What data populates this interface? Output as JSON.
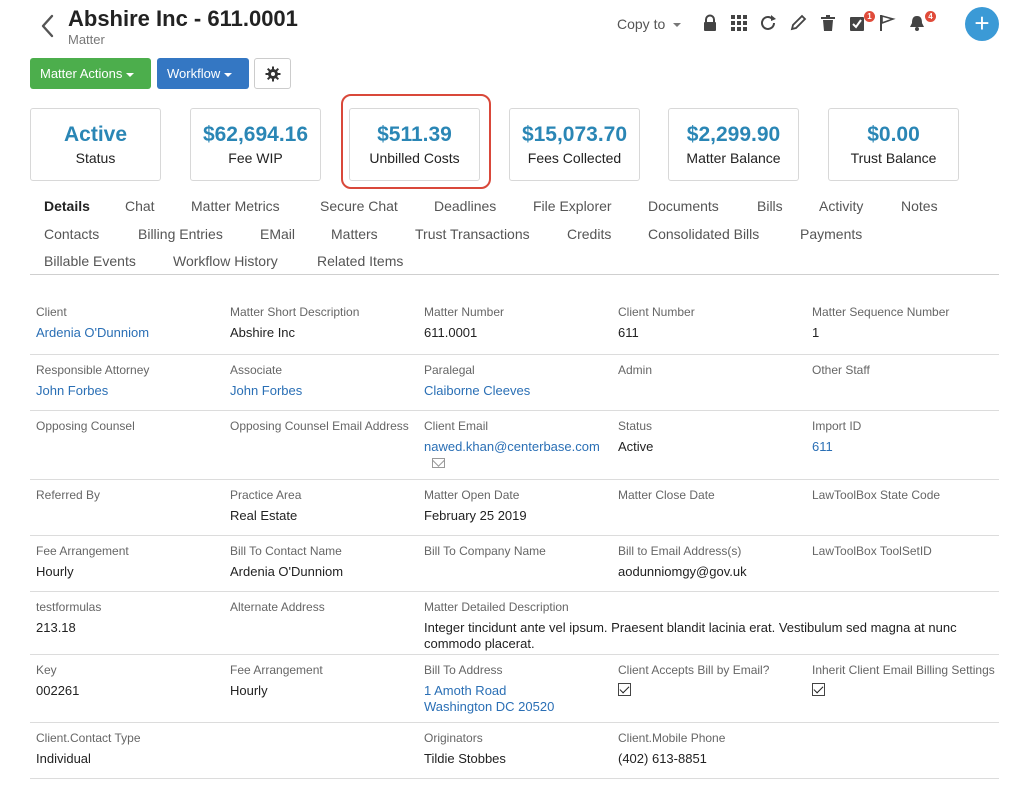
{
  "header": {
    "title": "Abshire Inc - 611.0001",
    "subtitle": "Matter",
    "copy_to": "Copy to",
    "task_badge": "1",
    "notification_badge": "4",
    "add_label": "+"
  },
  "actions": {
    "matter_actions": "Matter Actions",
    "workflow": "Workflow"
  },
  "stats": [
    {
      "value": "Active",
      "label": "Status"
    },
    {
      "value": "$62,694.16",
      "label": "Fee WIP"
    },
    {
      "value": "$511.39",
      "label": "Unbilled Costs"
    },
    {
      "value": "$15,073.70",
      "label": "Fees Collected"
    },
    {
      "value": "$2,299.90",
      "label": "Matter Balance"
    },
    {
      "value": "$0.00",
      "label": "Trust Balance"
    }
  ],
  "tabs": [
    "Details",
    "Chat",
    "Matter Metrics",
    "Secure Chat",
    "Deadlines",
    "File Explorer",
    "Documents",
    "Bills",
    "Activity",
    "Notes",
    "Contacts",
    "Billing Entries",
    "EMail",
    "Matters",
    "Trust Transactions",
    "Credits",
    "Consolidated Bills",
    "Payments",
    "Billable Events",
    "Workflow History",
    "Related Items"
  ],
  "details": [
    [
      {
        "label": "Client",
        "value": "Ardenia O'Dunniom",
        "link": true
      },
      {
        "label": "Matter Short Description",
        "value": "Abshire Inc"
      },
      {
        "label": "Matter Number",
        "value": "611.0001"
      },
      {
        "label": "Client Number",
        "value": "611"
      },
      {
        "label": "Matter Sequence Number",
        "value": "1"
      }
    ],
    [
      {
        "label": "Responsible Attorney",
        "value": "John Forbes",
        "link": true
      },
      {
        "label": "Associate",
        "value": "John Forbes",
        "link": true
      },
      {
        "label": "Paralegal",
        "value": "Claiborne Cleeves",
        "link": true
      },
      {
        "label": "Admin",
        "value": ""
      },
      {
        "label": "Other Staff",
        "value": ""
      }
    ],
    [
      {
        "label": "Opposing Counsel",
        "value": ""
      },
      {
        "label": "Opposing Counsel Email Address",
        "value": ""
      },
      {
        "label": "Client Email",
        "value": "nawed.khan@centerbase.com",
        "link": true
      },
      {
        "label": "Status",
        "value": "Active"
      },
      {
        "label": "Import ID",
        "value": "611",
        "link": true
      }
    ],
    [
      {
        "label": "Referred By",
        "value": ""
      },
      {
        "label": "Practice Area",
        "value": "Real Estate"
      },
      {
        "label": "Matter Open Date",
        "value": "February 25 2019"
      },
      {
        "label": "Matter Close Date",
        "value": ""
      },
      {
        "label": "LawToolBox State Code",
        "value": ""
      }
    ],
    [
      {
        "label": "Fee Arrangement",
        "value": "Hourly"
      },
      {
        "label": "Bill To Contact Name",
        "value": "Ardenia O'Dunniom"
      },
      {
        "label": "Bill To Company Name",
        "value": ""
      },
      {
        "label": "Bill to Email Address(s)",
        "value": "aodunniomgy@gov.uk"
      },
      {
        "label": "LawToolBox ToolSetID",
        "value": ""
      }
    ],
    [
      {
        "label": "testformulas",
        "value": "213.18"
      },
      {
        "label": "Alternate Address",
        "value": ""
      },
      {
        "label": "Matter Detailed Description",
        "value": "Integer tincidunt ante vel ipsum. Praesent blandit lacinia erat. Vestibulum sed magna at nunc commodo placerat."
      }
    ],
    [
      {
        "label": "Key",
        "value": "002261"
      },
      {
        "label": "Fee Arrangement",
        "value": "Hourly"
      },
      {
        "label": "Bill To Address",
        "value": "1 Amoth Road",
        "value2": "Washington DC 20520",
        "link": true
      },
      {
        "label": "Client Accepts Bill by Email?",
        "value": ""
      },
      {
        "label": "Inherit Client Email Billing Settings",
        "value": ""
      }
    ],
    [
      {
        "label": "Client.Contact Type",
        "value": "Individual"
      },
      {
        "label": "",
        "value": ""
      },
      {
        "label": "Originators",
        "value": "Tildie Stobbes"
      },
      {
        "label": "Client.Mobile Phone",
        "value": "(402) 613-8851"
      },
      {
        "label": "",
        "value": ""
      }
    ]
  ]
}
